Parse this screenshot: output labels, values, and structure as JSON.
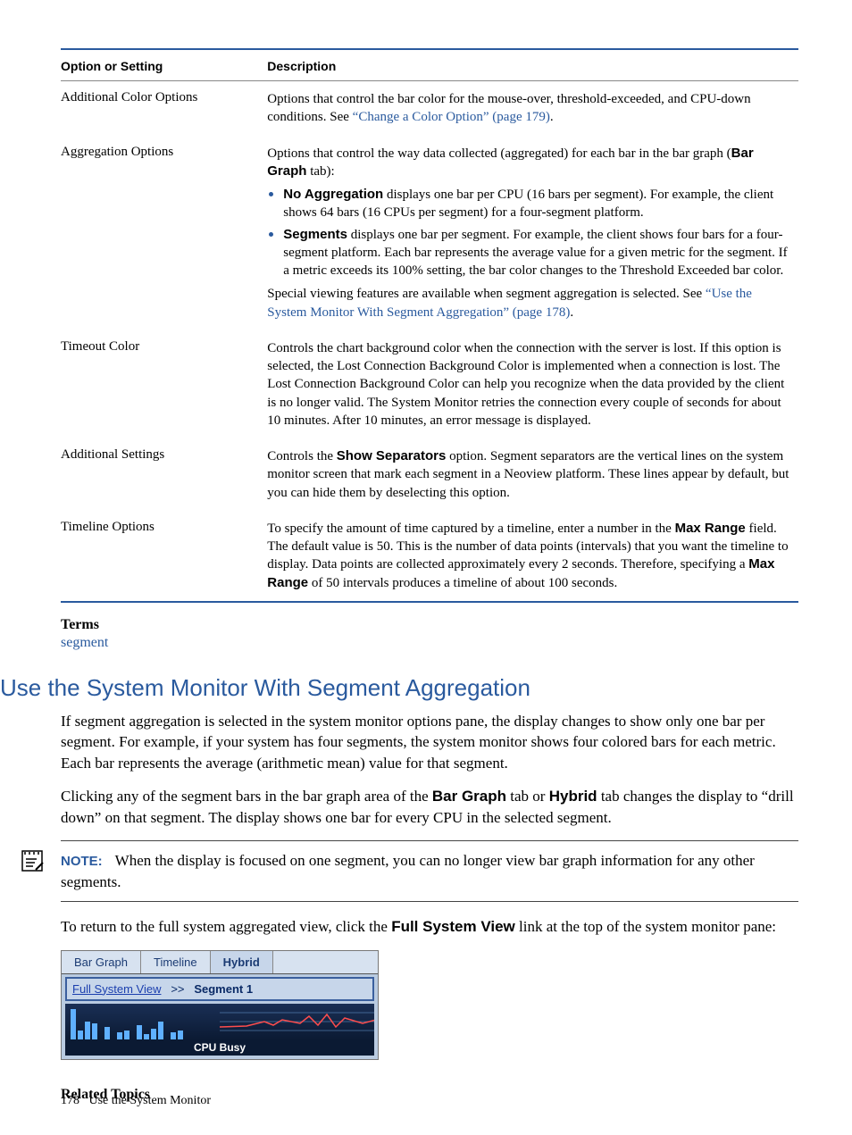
{
  "table": {
    "header_option": "Option or Setting",
    "header_desc": "Description",
    "rows": [
      {
        "option": "Additional Color Options",
        "p1_a": "Options that control the bar color for the mouse-over, threshold-exceeded, and CPU-down conditions. See ",
        "p1_link": "“Change a Color Option” (page 179)",
        "p1_b": "."
      },
      {
        "option": "Aggregation Options",
        "p1_a": "Options that control the way data collected (aggregated) for each bar in the bar graph (",
        "p1_bold": "Bar Graph",
        "p1_b": " tab):",
        "li1_bold": "No Aggregation",
        "li1_text": " displays one bar per CPU (16 bars per segment). For example, the client shows 64 bars (16 CPUs per segment) for a four-segment platform.",
        "li2_bold": "Segments",
        "li2_text": " displays one bar per segment. For example, the client shows four bars for a four-segment platform. Each bar represents the average value for a given metric for the segment. If a metric exceeds its 100% setting, the bar color changes to the Threshold Exceeded bar color.",
        "p2_a": "Special viewing features are available when segment aggregation is selected. See ",
        "p2_link": "“Use the System Monitor With Segment Aggregation” (page 178)",
        "p2_b": "."
      },
      {
        "option": "Timeout Color",
        "p1": "Controls the chart background color when the connection with the server is lost. If this option is selected, the Lost Connection Background Color is implemented when a connection is lost. The Lost Connection Background Color can help you recognize when the data provided by the client is no longer valid. The System Monitor retries the connection every couple of seconds for about 10 minutes. After 10 minutes, an error message is displayed."
      },
      {
        "option": "Additional Settings",
        "p1_a": "Controls the ",
        "p1_bold": "Show Separators",
        "p1_b": " option. Segment separators are the vertical lines on the system monitor screen that mark each segment in a Neoview platform. These lines appear by default, but you can hide them by deselecting this option."
      },
      {
        "option": "Timeline Options",
        "p1_a": "To specify the amount of time captured by a timeline, enter a number in the ",
        "p1_bold1": "Max Range",
        "p1_b": " field. The default value is 50. This is the number of data points (intervals) that you want the timeline to display. Data points are collected approximately every 2 seconds. Therefore, specifying a ",
        "p1_bold2": "Max Range",
        "p1_c": " of 50 intervals produces a timeline of about 100 seconds."
      }
    ]
  },
  "terms": {
    "heading": "Terms",
    "item": "segment"
  },
  "section": {
    "heading": "Use the System Monitor With Segment Aggregation",
    "p1": "If segment aggregation is selected in the system monitor options pane, the display changes to show only one bar per segment. For example, if your system has four segments, the system monitor shows four colored bars for each metric. Each bar represents the average (arithmetic mean) value for that segment.",
    "p2_a": "Clicking any of the segment bars in the bar graph area of the ",
    "p2_b1": "Bar Graph",
    "p2_b": " tab or ",
    "p2_b2": "Hybrid",
    "p2_c": " tab changes the display to “drill down” on that segment. The display shows one bar for every CPU in the selected segment."
  },
  "note": {
    "label": "NOTE:",
    "text": "When the display is focused on one segment, you can no longer view bar graph information for any other segments."
  },
  "p3_a": "To return to the full system aggregated view, click the ",
  "p3_bold": "Full System View",
  "p3_b": " link at the top of the system monitor pane:",
  "sshot": {
    "tab1": "Bar Graph",
    "tab2": "Timeline",
    "tab3": "Hybrid",
    "bc_link": "Full System View",
    "bc_sep": ">>",
    "bc_cur": "Segment  1",
    "caption": "CPU Busy"
  },
  "related": "Related Topics",
  "footer": {
    "page": "178",
    "title": "Use the System Monitor"
  }
}
